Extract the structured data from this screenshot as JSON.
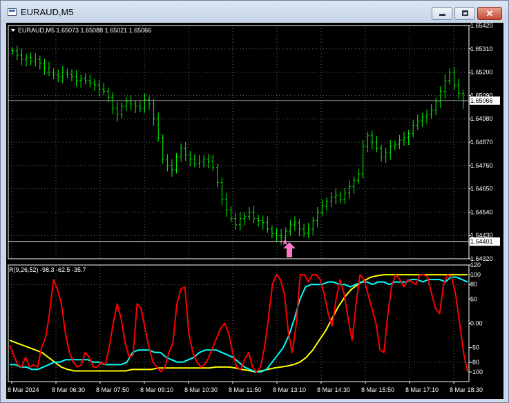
{
  "window": {
    "title": "EURAUD,M5",
    "minimize_icon": "minimize-icon",
    "maximize_icon": "maximize-icon",
    "close_icon": "close-icon",
    "close_glyph": "✕"
  },
  "chart_data": [
    {
      "type": "bar",
      "title": "EURAUD,M5  1.65073 1.65088 1.65021 1.65066",
      "symbol": "EURAUD,M5",
      "ohlc": {
        "open": "1.65073",
        "high": "1.65088",
        "low": "1.65021",
        "close": "1.65066"
      },
      "y_ticks": [
        "1.65420",
        "1.65310",
        "1.65200",
        "1.65090",
        "1.64980",
        "1.64870",
        "1.64760",
        "1.64650",
        "1.64540",
        "1.64430",
        "1.64320"
      ],
      "ylim": [
        1.6432,
        1.6542
      ],
      "current_price": "1.65066",
      "level_line": "1.64401",
      "bar_color": "#00ff00",
      "grid": "dotted",
      "series": [
        {
          "name": "EURAUD,M5",
          "values": [
            1.653,
            1.6528,
            1.6526,
            1.6527,
            1.6525,
            1.6526,
            1.6524,
            1.6522,
            1.652,
            1.6519,
            1.6518,
            1.652,
            1.6519,
            1.6518,
            1.6516,
            1.6517,
            1.6516,
            1.6515,
            1.6514,
            1.6512,
            1.6511,
            1.6508,
            1.6503,
            1.65,
            1.6504,
            1.6506,
            1.6505,
            1.6504,
            1.6503,
            1.6507,
            1.6505,
            1.6498,
            1.6489,
            1.6479,
            1.6476,
            1.6474,
            1.648,
            1.6484,
            1.6481,
            1.6479,
            1.6477,
            1.6478,
            1.6479,
            1.6478,
            1.6475,
            1.6468,
            1.646,
            1.6455,
            1.6451,
            1.6448,
            1.6451,
            1.6452,
            1.6454,
            1.6451,
            1.645,
            1.6449,
            1.6446,
            1.6444,
            1.6443,
            1.6442,
            1.6445,
            1.6448,
            1.6449,
            1.6446,
            1.6444,
            1.6446,
            1.645,
            1.6454,
            1.6457,
            1.6459,
            1.6461,
            1.6462,
            1.646,
            1.6463,
            1.6466,
            1.6469,
            1.6472,
            1.6485,
            1.649,
            1.6487,
            1.6484,
            1.648,
            1.6482,
            1.6485,
            1.6486,
            1.6488,
            1.6489,
            1.6491,
            1.6495,
            1.6497,
            1.6499,
            1.65,
            1.6502,
            1.6506,
            1.6511,
            1.6516,
            1.652,
            1.6514,
            1.651,
            1.6506
          ]
        }
      ]
    },
    {
      "type": "line",
      "title": "R(9,26,52) -98.3 -62.5 -35.7",
      "label": "R(9,26,52)",
      "values_text": "-98.3 -62.5 -35.7",
      "y_ticks": [
        "120",
        "100",
        "80",
        "50",
        "0.00",
        "-50",
        "-80",
        "-100"
      ],
      "ylim": [
        -120,
        120
      ],
      "levels": [
        80,
        -80
      ],
      "series": [
        {
          "color": "#ff0000",
          "values": [
            -45,
            -65,
            -85,
            -90,
            -70,
            -90,
            -85,
            -90,
            -50,
            -30,
            20,
            90,
            70,
            40,
            -20,
            -60,
            -80,
            -90,
            -85,
            -60,
            -70,
            -90,
            -90,
            -80,
            -85,
            -50,
            0,
            40,
            10,
            -40,
            -70,
            -65,
            40,
            30,
            -10,
            -50,
            -80,
            -90,
            -100,
            -90,
            -60,
            -40,
            40,
            70,
            75,
            -20,
            -60,
            -80,
            -90,
            -85,
            -70,
            -50,
            -30,
            -10,
            0,
            -20,
            -60,
            -90,
            -95,
            -75,
            -60,
            -90,
            -100,
            -90,
            -50,
            10,
            80,
            100,
            90,
            60,
            -20,
            -60,
            0,
            100,
            100,
            85,
            100,
            100,
            90,
            60,
            20,
            -5,
            50,
            90,
            60,
            10,
            -35,
            40,
            100,
            90,
            60,
            30,
            0,
            -55,
            -60,
            20,
            80,
            100,
            90,
            75,
            90,
            85,
            80,
            100,
            100,
            95,
            60,
            30,
            20,
            80,
            100,
            95,
            60,
            0,
            -60,
            -100
          ]
        },
        {
          "color": "#00ffff",
          "values": [
            -85,
            -85,
            -90,
            -90,
            -95,
            -95,
            -90,
            -85,
            -80,
            -80,
            -75,
            -75,
            -75,
            -75,
            -75,
            -80,
            -80,
            -85,
            -85,
            -85,
            -85,
            -80,
            -60,
            -55,
            -55,
            -55,
            -60,
            -60,
            -70,
            -75,
            -80,
            -80,
            -75,
            -70,
            -60,
            -55,
            -55,
            -55,
            -60,
            -65,
            -70,
            -80,
            -90,
            -95,
            -100,
            -100,
            -95,
            -80,
            -65,
            -50,
            -25,
            10,
            50,
            75,
            80,
            80,
            80,
            85,
            85,
            80,
            80,
            75,
            80,
            85,
            85,
            80,
            85,
            85,
            80,
            85,
            85,
            85,
            90,
            90,
            85,
            90,
            90,
            90,
            85,
            95,
            95,
            90,
            85
          ]
        },
        {
          "color": "#ffff00",
          "values": [
            -35,
            -40,
            -45,
            -50,
            -55,
            -60,
            -70,
            -80,
            -90,
            -95,
            -98,
            -98,
            -98,
            -98,
            -98,
            -98,
            -98,
            -98,
            -98,
            -95,
            -95,
            -95,
            -95,
            -92,
            -92,
            -92,
            -92,
            -92,
            -92,
            -92,
            -92,
            -92,
            -90,
            -90,
            -90,
            -92,
            -95,
            -97,
            -100,
            -98,
            -95,
            -92,
            -90,
            -88,
            -85,
            -80,
            -70,
            -55,
            -35,
            -15,
            10,
            35,
            55,
            70,
            80,
            88,
            95,
            98,
            100,
            100,
            100,
            100,
            100,
            100,
            100,
            100,
            100,
            100,
            100,
            100,
            100,
            100
          ]
        }
      ]
    }
  ],
  "time_axis": [
    "8 Mar 2024",
    "8 Mar 06:30",
    "8 Mar 07:50",
    "8 Mar 09:10",
    "8 Mar 10:30",
    "8 Mar 11:50",
    "8 Mar 13:10",
    "8 Mar 14:30",
    "8 Mar 15:50",
    "8 Mar 17:10",
    "8 Mar 18:30"
  ],
  "signals": {
    "star_color": "#ff77c8",
    "arrow_color": "#ff77c8",
    "star_glyph": "★",
    "star_name": "signal-star-icon",
    "arrow_name": "buy-arrow-icon"
  }
}
